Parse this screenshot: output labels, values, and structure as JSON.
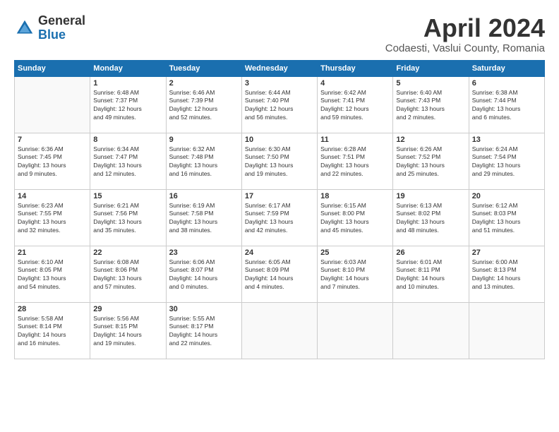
{
  "header": {
    "logo_general": "General",
    "logo_blue": "Blue",
    "month_title": "April 2024",
    "location": "Codaesti, Vaslui County, Romania"
  },
  "calendar": {
    "days_of_week": [
      "Sunday",
      "Monday",
      "Tuesday",
      "Wednesday",
      "Thursday",
      "Friday",
      "Saturday"
    ],
    "weeks": [
      [
        {
          "day": "",
          "info": ""
        },
        {
          "day": "1",
          "info": "Sunrise: 6:48 AM\nSunset: 7:37 PM\nDaylight: 12 hours\nand 49 minutes."
        },
        {
          "day": "2",
          "info": "Sunrise: 6:46 AM\nSunset: 7:39 PM\nDaylight: 12 hours\nand 52 minutes."
        },
        {
          "day": "3",
          "info": "Sunrise: 6:44 AM\nSunset: 7:40 PM\nDaylight: 12 hours\nand 56 minutes."
        },
        {
          "day": "4",
          "info": "Sunrise: 6:42 AM\nSunset: 7:41 PM\nDaylight: 12 hours\nand 59 minutes."
        },
        {
          "day": "5",
          "info": "Sunrise: 6:40 AM\nSunset: 7:43 PM\nDaylight: 13 hours\nand 2 minutes."
        },
        {
          "day": "6",
          "info": "Sunrise: 6:38 AM\nSunset: 7:44 PM\nDaylight: 13 hours\nand 6 minutes."
        }
      ],
      [
        {
          "day": "7",
          "info": "Sunrise: 6:36 AM\nSunset: 7:45 PM\nDaylight: 13 hours\nand 9 minutes."
        },
        {
          "day": "8",
          "info": "Sunrise: 6:34 AM\nSunset: 7:47 PM\nDaylight: 13 hours\nand 12 minutes."
        },
        {
          "day": "9",
          "info": "Sunrise: 6:32 AM\nSunset: 7:48 PM\nDaylight: 13 hours\nand 16 minutes."
        },
        {
          "day": "10",
          "info": "Sunrise: 6:30 AM\nSunset: 7:50 PM\nDaylight: 13 hours\nand 19 minutes."
        },
        {
          "day": "11",
          "info": "Sunrise: 6:28 AM\nSunset: 7:51 PM\nDaylight: 13 hours\nand 22 minutes."
        },
        {
          "day": "12",
          "info": "Sunrise: 6:26 AM\nSunset: 7:52 PM\nDaylight: 13 hours\nand 25 minutes."
        },
        {
          "day": "13",
          "info": "Sunrise: 6:24 AM\nSunset: 7:54 PM\nDaylight: 13 hours\nand 29 minutes."
        }
      ],
      [
        {
          "day": "14",
          "info": "Sunrise: 6:23 AM\nSunset: 7:55 PM\nDaylight: 13 hours\nand 32 minutes."
        },
        {
          "day": "15",
          "info": "Sunrise: 6:21 AM\nSunset: 7:56 PM\nDaylight: 13 hours\nand 35 minutes."
        },
        {
          "day": "16",
          "info": "Sunrise: 6:19 AM\nSunset: 7:58 PM\nDaylight: 13 hours\nand 38 minutes."
        },
        {
          "day": "17",
          "info": "Sunrise: 6:17 AM\nSunset: 7:59 PM\nDaylight: 13 hours\nand 42 minutes."
        },
        {
          "day": "18",
          "info": "Sunrise: 6:15 AM\nSunset: 8:00 PM\nDaylight: 13 hours\nand 45 minutes."
        },
        {
          "day": "19",
          "info": "Sunrise: 6:13 AM\nSunset: 8:02 PM\nDaylight: 13 hours\nand 48 minutes."
        },
        {
          "day": "20",
          "info": "Sunrise: 6:12 AM\nSunset: 8:03 PM\nDaylight: 13 hours\nand 51 minutes."
        }
      ],
      [
        {
          "day": "21",
          "info": "Sunrise: 6:10 AM\nSunset: 8:05 PM\nDaylight: 13 hours\nand 54 minutes."
        },
        {
          "day": "22",
          "info": "Sunrise: 6:08 AM\nSunset: 8:06 PM\nDaylight: 13 hours\nand 57 minutes."
        },
        {
          "day": "23",
          "info": "Sunrise: 6:06 AM\nSunset: 8:07 PM\nDaylight: 14 hours\nand 0 minutes."
        },
        {
          "day": "24",
          "info": "Sunrise: 6:05 AM\nSunset: 8:09 PM\nDaylight: 14 hours\nand 4 minutes."
        },
        {
          "day": "25",
          "info": "Sunrise: 6:03 AM\nSunset: 8:10 PM\nDaylight: 14 hours\nand 7 minutes."
        },
        {
          "day": "26",
          "info": "Sunrise: 6:01 AM\nSunset: 8:11 PM\nDaylight: 14 hours\nand 10 minutes."
        },
        {
          "day": "27",
          "info": "Sunrise: 6:00 AM\nSunset: 8:13 PM\nDaylight: 14 hours\nand 13 minutes."
        }
      ],
      [
        {
          "day": "28",
          "info": "Sunrise: 5:58 AM\nSunset: 8:14 PM\nDaylight: 14 hours\nand 16 minutes."
        },
        {
          "day": "29",
          "info": "Sunrise: 5:56 AM\nSunset: 8:15 PM\nDaylight: 14 hours\nand 19 minutes."
        },
        {
          "day": "30",
          "info": "Sunrise: 5:55 AM\nSunset: 8:17 PM\nDaylight: 14 hours\nand 22 minutes."
        },
        {
          "day": "",
          "info": ""
        },
        {
          "day": "",
          "info": ""
        },
        {
          "day": "",
          "info": ""
        },
        {
          "day": "",
          "info": ""
        }
      ]
    ]
  }
}
